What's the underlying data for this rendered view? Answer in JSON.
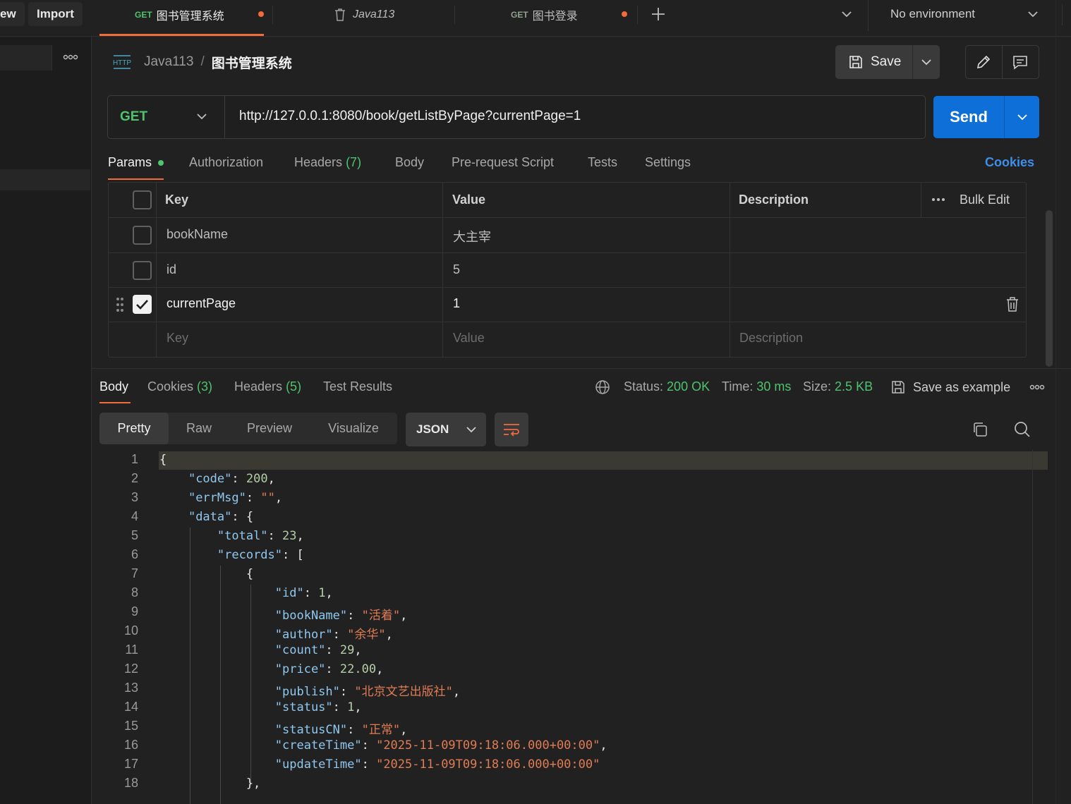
{
  "topbar": {
    "new_label": "ew",
    "import_label": "Import",
    "tabs": [
      {
        "method": "GET",
        "title": "图书管理系统",
        "unsaved": true
      },
      {
        "title": "Java113"
      },
      {
        "method": "GET",
        "title": "图书登录",
        "unsaved": true
      }
    ],
    "environment": "No environment"
  },
  "header": {
    "icon_text": "HTTP",
    "collection": "Java113",
    "separator": "/",
    "request_name": "图书管理系统",
    "save_label": "Save"
  },
  "request": {
    "method": "GET",
    "url": "http://127.0.0.1:8080/book/getListByPage?currentPage=1",
    "send_label": "Send"
  },
  "request_tabs": {
    "params": "Params",
    "authorization": "Authorization",
    "headers": "Headers",
    "headers_count": "(7)",
    "body": "Body",
    "prerequest": "Pre-request Script",
    "tests": "Tests",
    "settings": "Settings",
    "cookies": "Cookies"
  },
  "params_table": {
    "headers": {
      "key": "Key",
      "value": "Value",
      "description": "Description",
      "bulk_edit": "Bulk Edit"
    },
    "rows": [
      {
        "key": "bookName",
        "value": "大主宰",
        "checked": false
      },
      {
        "key": "id",
        "value": "5",
        "checked": false
      },
      {
        "key": "currentPage",
        "value": "1",
        "checked": true
      }
    ],
    "placeholders": {
      "key": "Key",
      "value": "Value",
      "description": "Description"
    }
  },
  "response": {
    "tabs": {
      "body": "Body",
      "cookies": "Cookies",
      "cookies_count": "(3)",
      "headers": "Headers",
      "headers_count": "(5)",
      "test_results": "Test Results"
    },
    "status_label": "Status:",
    "status_value": "200 OK",
    "time_label": "Time:",
    "time_value": "30 ms",
    "size_label": "Size:",
    "size_value": "2.5 KB",
    "save_example": "Save as example",
    "formats": [
      "Pretty",
      "Raw",
      "Preview",
      "Visualize"
    ],
    "language": "JSON"
  },
  "code_lines": [
    "1",
    "2",
    "3",
    "4",
    "5",
    "6",
    "7",
    "8",
    "9",
    "10",
    "11",
    "12",
    "13",
    "14",
    "15",
    "16",
    "17",
    "18"
  ],
  "json": {
    "code": "200",
    "errMsg": "\"\"",
    "total": "23",
    "id": "1",
    "bookName": "\"活着\"",
    "author": "\"余华\"",
    "count": "29",
    "price": "22.00",
    "publish": "\"北京文艺出版社\"",
    "status": "1",
    "statusCN": "\"正常\"",
    "createTime": "\"2025-11-09T09:18:06.000+00:00\"",
    "updateTime": "\"2025-11-09T09:18:06.000+00:00\""
  },
  "colors": {
    "accent": "#f26b3a",
    "send": "#0f6fd8",
    "success": "#4fc36e",
    "json_key": "#8fc8ef",
    "json_string": "#e07c54",
    "json_number": "#b5cea8"
  }
}
